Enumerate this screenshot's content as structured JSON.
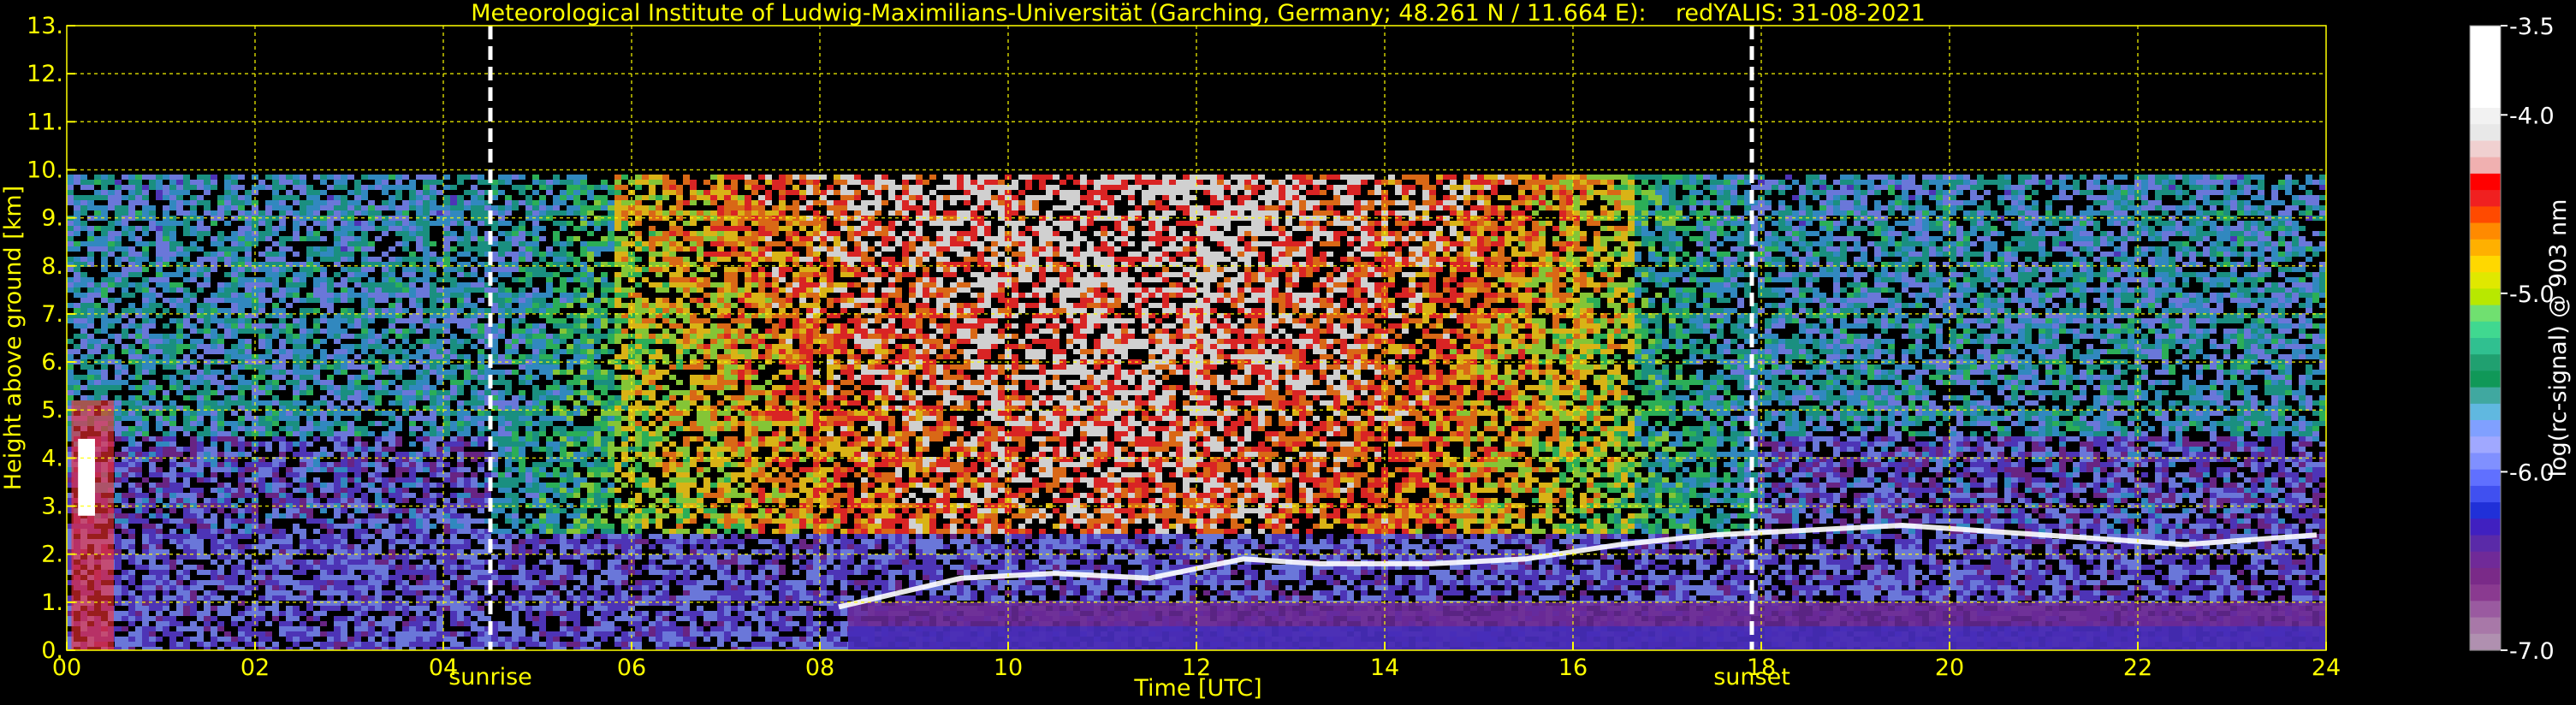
{
  "chart_data": {
    "type": "heatmap",
    "title": "Meteorological Institute of Ludwig-Maximilians-Universität (Garching, Germany; 48.261 N / 11.664 E):    redYALIS: 31-08-2021",
    "xlabel": "Time [UTC]",
    "ylabel": "Height above ground [km]",
    "xlim": [
      0,
      24
    ],
    "ylim": [
      0,
      13
    ],
    "x_ticks": [
      "00",
      "02",
      "04",
      "06",
      "08",
      "10",
      "12",
      "14",
      "16",
      "18",
      "20",
      "22",
      "24"
    ],
    "y_ticks": [
      "0.",
      "1.",
      "2.",
      "3.",
      "4.",
      "5.",
      "6.",
      "7.",
      "8.",
      "9.",
      "10.",
      "11.",
      "12.",
      "13."
    ],
    "grid": true,
    "grid_color": "#ffff00",
    "markers": [
      {
        "label": "sunrise",
        "time": 4.5
      },
      {
        "label": "sunset",
        "time": 17.9
      }
    ],
    "colorbar": {
      "label": "log(rc-signal) @ 903 nm",
      "range": [
        -7.0,
        -3.5
      ],
      "ticks": [
        "-3.5",
        "-4.0",
        "-5.0",
        "-6.0",
        "-7.0"
      ],
      "tick_values": [
        -3.5,
        -4.0,
        -5.0,
        -6.0,
        -7.0
      ]
    },
    "data_max_height_km": 10,
    "cloud_base_layer": [
      {
        "t": 8.2,
        "h": 0.9
      },
      {
        "t": 9.5,
        "h": 1.5
      },
      {
        "t": 10.5,
        "h": 1.6
      },
      {
        "t": 11.5,
        "h": 1.5
      },
      {
        "t": 12.5,
        "h": 1.9
      },
      {
        "t": 13.3,
        "h": 1.8
      },
      {
        "t": 14.5,
        "h": 1.8
      },
      {
        "t": 15.5,
        "h": 1.9
      },
      {
        "t": 16.5,
        "h": 2.2
      },
      {
        "t": 17.5,
        "h": 2.4
      },
      {
        "t": 18.5,
        "h": 2.5
      },
      {
        "t": 19.5,
        "h": 2.6
      },
      {
        "t": 21.0,
        "h": 2.4
      },
      {
        "t": 22.5,
        "h": 2.2
      },
      {
        "t": 23.9,
        "h": 2.4
      }
    ],
    "colors": {
      "axis_text": "#ffff00",
      "colorbar_text": "#ffffff",
      "background": "#000000"
    }
  }
}
